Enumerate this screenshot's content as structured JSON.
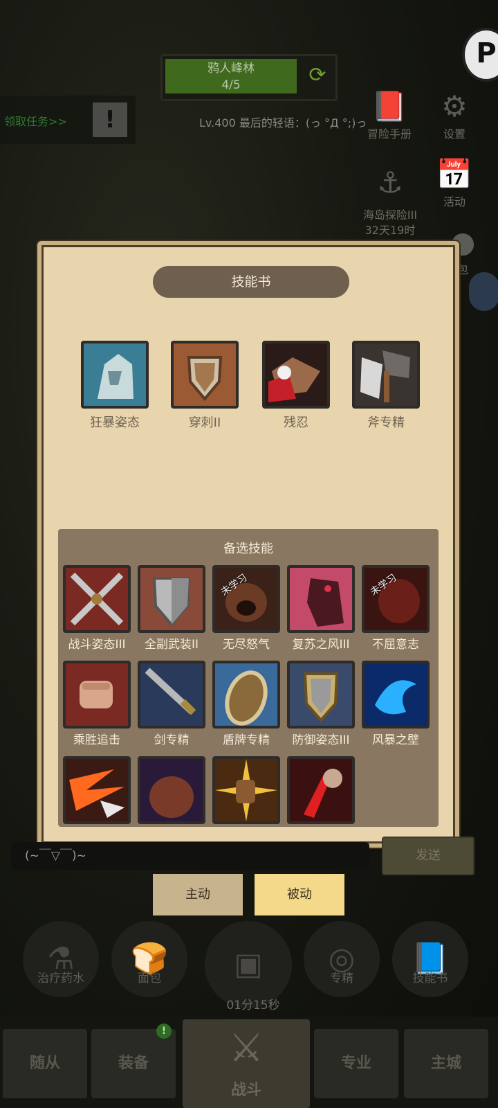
{
  "zone": {
    "name": "鸦人峰林",
    "progress": "4/5"
  },
  "quest": {
    "label": "领取任务>>",
    "button": "!"
  },
  "player_line": "Lv.400 最后的轻语：(っ °Д °;)っ",
  "side_icons": [
    {
      "label": "冒险手册",
      "icon": "book-icon"
    },
    {
      "label": "设置",
      "icon": "gear-icon"
    },
    {
      "label": "海岛探险III\n32天19时",
      "icon": "anchor-icon"
    },
    {
      "label": "活动",
      "icon": "calendar-icon"
    },
    {
      "label": "包",
      "icon": "coin-icon"
    }
  ],
  "panel": {
    "title": "技能书",
    "equipped": [
      "狂暴姿态",
      "穿刺II",
      "残忍",
      "斧专精"
    ],
    "candidates_title": "备选技能",
    "unlearned_label": "未学习",
    "candidates": [
      {
        "name": "战斗姿态III",
        "unlearned": false
      },
      {
        "name": "全副武装II",
        "unlearned": false
      },
      {
        "name": "无尽怒气",
        "unlearned": true
      },
      {
        "name": "复苏之风III",
        "unlearned": false
      },
      {
        "name": "不屈意志",
        "unlearned": true
      },
      {
        "name": "乘胜追击",
        "unlearned": false
      },
      {
        "name": "剑专精",
        "unlearned": false
      },
      {
        "name": "盾牌专精",
        "unlearned": false
      },
      {
        "name": "防御姿态III",
        "unlearned": false
      },
      {
        "name": "风暴之壁",
        "unlearned": false
      }
    ]
  },
  "chat": {
    "input_text": "(~￣▽￣)~",
    "send_label": "发送"
  },
  "tabs": {
    "active_label": "主动",
    "passive_label": "被动"
  },
  "quick_bar": {
    "potion": "治疗药水",
    "bread": "面包",
    "timer": "01分15秒",
    "spec": "专精",
    "skillbook": "技能书"
  },
  "nav": {
    "followers": "随从",
    "equipment": "装备",
    "battle": "战斗",
    "profession": "专业",
    "city": "主城",
    "badge": "!"
  }
}
